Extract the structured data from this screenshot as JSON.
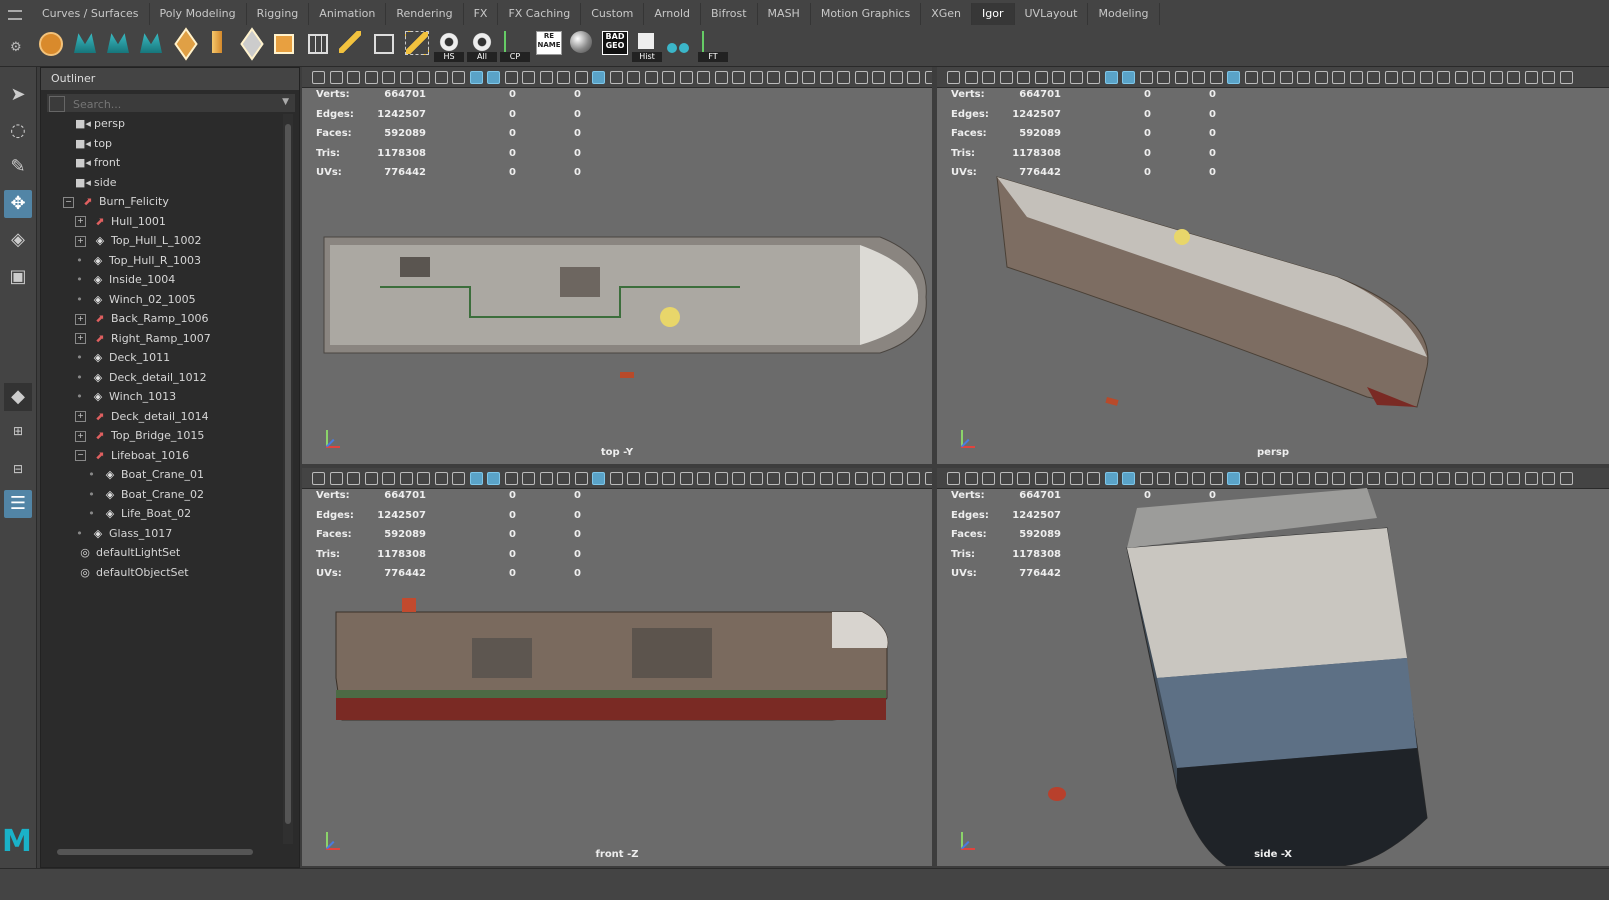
{
  "shelf_tabs": [
    "Curves / Surfaces",
    "Poly Modeling",
    "Rigging",
    "Animation",
    "Rendering",
    "FX",
    "FX Caching",
    "Custom",
    "Arnold",
    "Bifrost",
    "MASH",
    "Motion Graphics",
    "XGen",
    "Igor",
    "UVLayout",
    "Modeling"
  ],
  "active_tab": "Igor",
  "shelf_labels": {
    "hs": "HS",
    "all": "All",
    "cp": "CP",
    "rename": "RE NAME",
    "badgeo": "BAD GEO",
    "hist": "Hist",
    "ft": "FT"
  },
  "outliner": {
    "title": "Outliner",
    "search_placeholder": "Search...",
    "items": [
      {
        "label": "persp",
        "icon": "camera-icon",
        "indent": 1,
        "exp": "none"
      },
      {
        "label": "top",
        "icon": "camera-icon",
        "indent": 1,
        "exp": "none"
      },
      {
        "label": "front",
        "icon": "camera-icon",
        "indent": 1,
        "exp": "none"
      },
      {
        "label": "side",
        "icon": "camera-icon",
        "indent": 1,
        "exp": "none"
      },
      {
        "label": "Burn_Felicity",
        "icon": "group-icon",
        "indent": 0,
        "exp": "minus"
      },
      {
        "label": "Hull_1001",
        "icon": "group-icon",
        "indent": 1,
        "exp": "plus"
      },
      {
        "label": "Top_Hull_L_1002",
        "icon": "mesh-icon",
        "indent": 1,
        "exp": "plus"
      },
      {
        "label": "Top_Hull_R_1003",
        "icon": "mesh-icon",
        "indent": 1,
        "exp": "dot"
      },
      {
        "label": "Inside_1004",
        "icon": "mesh-icon",
        "indent": 1,
        "exp": "dot"
      },
      {
        "label": "Winch_02_1005",
        "icon": "mesh-icon",
        "indent": 1,
        "exp": "dot"
      },
      {
        "label": "Back_Ramp_1006",
        "icon": "group-icon",
        "indent": 1,
        "exp": "plus"
      },
      {
        "label": "Right_Ramp_1007",
        "icon": "group-icon",
        "indent": 1,
        "exp": "plus"
      },
      {
        "label": "Deck_1011",
        "icon": "mesh-icon",
        "indent": 1,
        "exp": "dot"
      },
      {
        "label": "Deck_detail_1012",
        "icon": "mesh-icon",
        "indent": 1,
        "exp": "dot"
      },
      {
        "label": "Winch_1013",
        "icon": "mesh-icon",
        "indent": 1,
        "exp": "dot"
      },
      {
        "label": "Deck_detail_1014",
        "icon": "group-icon",
        "indent": 1,
        "exp": "plus"
      },
      {
        "label": "Top_Bridge_1015",
        "icon": "group-icon",
        "indent": 1,
        "exp": "plus"
      },
      {
        "label": "Lifeboat_1016",
        "icon": "group-icon",
        "indent": 1,
        "exp": "minus"
      },
      {
        "label": "Boat_Crane_01",
        "icon": "mesh-icon",
        "indent": 2,
        "exp": "dot"
      },
      {
        "label": "Boat_Crane_02",
        "icon": "mesh-icon",
        "indent": 2,
        "exp": "dot"
      },
      {
        "label": "Life_Boat_02",
        "icon": "mesh-icon",
        "indent": 2,
        "exp": "dot"
      },
      {
        "label": "Glass_1017",
        "icon": "mesh-icon",
        "indent": 1,
        "exp": "dot"
      },
      {
        "label": "defaultLightSet",
        "icon": "set-icon",
        "indent": 0,
        "exp": "none"
      },
      {
        "label": "defaultObjectSet",
        "icon": "set-icon",
        "indent": 0,
        "exp": "none"
      }
    ]
  },
  "stats": [
    {
      "label": "Verts:",
      "value": "664701",
      "a": "0",
      "b": "0"
    },
    {
      "label": "Edges:",
      "value": "1242507",
      "a": "0",
      "b": "0"
    },
    {
      "label": "Faces:",
      "value": "592089",
      "a": "0",
      "b": "0"
    },
    {
      "label": "Tris:",
      "value": "1178308",
      "a": "0",
      "b": "0"
    },
    {
      "label": "UVs:",
      "value": "776442",
      "a": "0",
      "b": "0"
    }
  ],
  "viewports": {
    "tl": {
      "label": "top -Y"
    },
    "tr": {
      "label": "persp"
    },
    "bl": {
      "label": "front -Z"
    },
    "br": {
      "label": "side -X"
    }
  },
  "colors": {
    "accent": "#5285a6",
    "viewport_bg": "#6b6b6b",
    "maya_logo": "#1ab2c8"
  }
}
